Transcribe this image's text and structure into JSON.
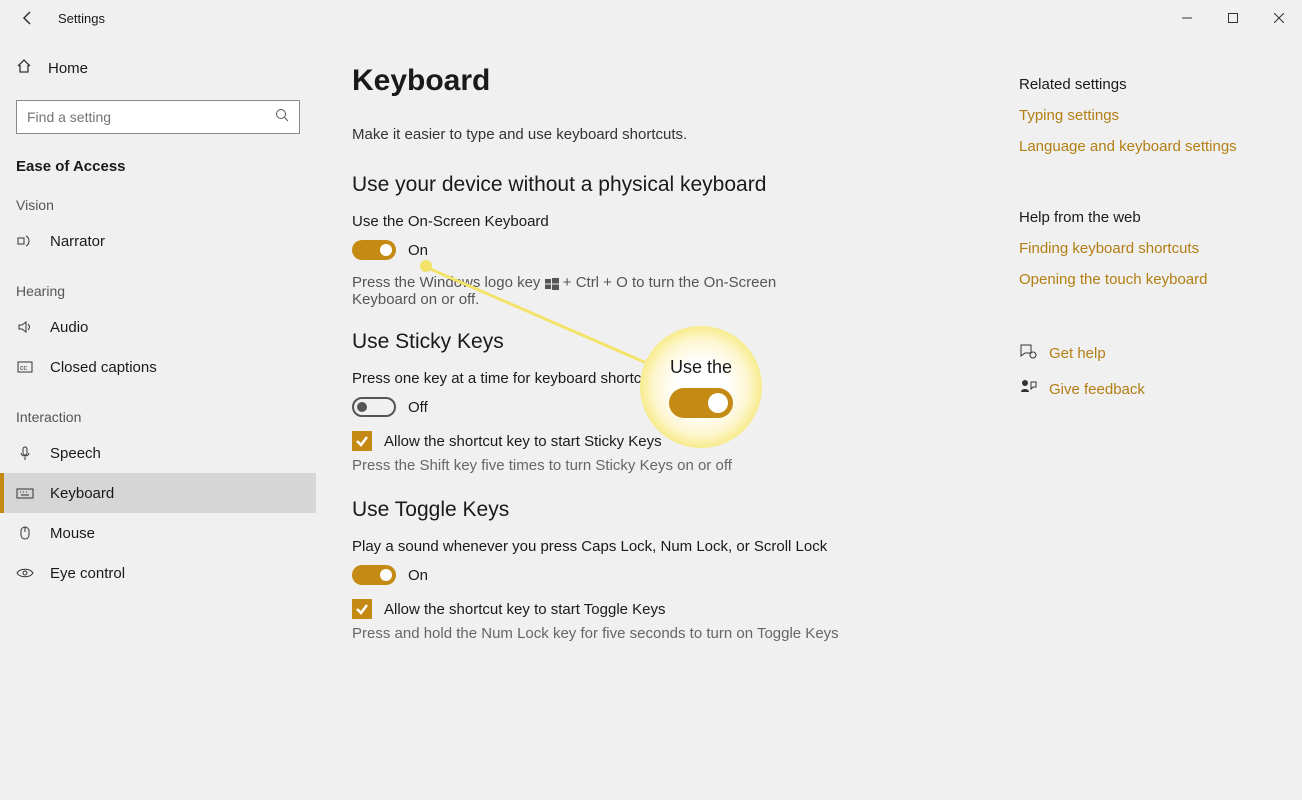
{
  "titlebar": {
    "title": "Settings"
  },
  "sidebar": {
    "home": "Home",
    "search_placeholder": "Find a setting",
    "section": "Ease of Access",
    "groups": {
      "vision": "Vision",
      "hearing": "Hearing",
      "interaction": "Interaction"
    },
    "items": {
      "narrator": "Narrator",
      "audio": "Audio",
      "closed_captions": "Closed captions",
      "speech": "Speech",
      "keyboard": "Keyboard",
      "mouse": "Mouse",
      "eye_control": "Eye control"
    }
  },
  "page": {
    "title": "Keyboard",
    "subtitle": "Make it easier to type and use keyboard shortcuts.",
    "sections": {
      "osk": {
        "title": "Use your device without a physical keyboard",
        "label": "Use the On-Screen Keyboard",
        "state": "On",
        "help_pre": "Press the Windows logo key ",
        "help_post": " + Ctrl + O to turn the On-Screen Keyboard on or off."
      },
      "sticky": {
        "title": "Use Sticky Keys",
        "label": "Press one key at a time for keyboard shortcuts",
        "state": "Off",
        "checkbox": "Allow the shortcut key to start Sticky Keys",
        "desc": "Press the Shift key five times to turn Sticky Keys on or off"
      },
      "toggle_keys": {
        "title": "Use Toggle Keys",
        "label": "Play a sound whenever you press Caps Lock, Num Lock, or Scroll Lock",
        "state": "On",
        "checkbox": "Allow the shortcut key to start Toggle Keys",
        "desc": "Press and hold the Num Lock key for five seconds to turn on Toggle Keys"
      }
    }
  },
  "right": {
    "related_head": "Related settings",
    "typing": "Typing settings",
    "lang": "Language and keyboard settings",
    "web_head": "Help from the web",
    "shortcuts": "Finding keyboard shortcuts",
    "touchkb": "Opening the touch keyboard",
    "get_help": "Get help",
    "feedback": "Give feedback"
  },
  "highlight": {
    "text": "Use the"
  }
}
